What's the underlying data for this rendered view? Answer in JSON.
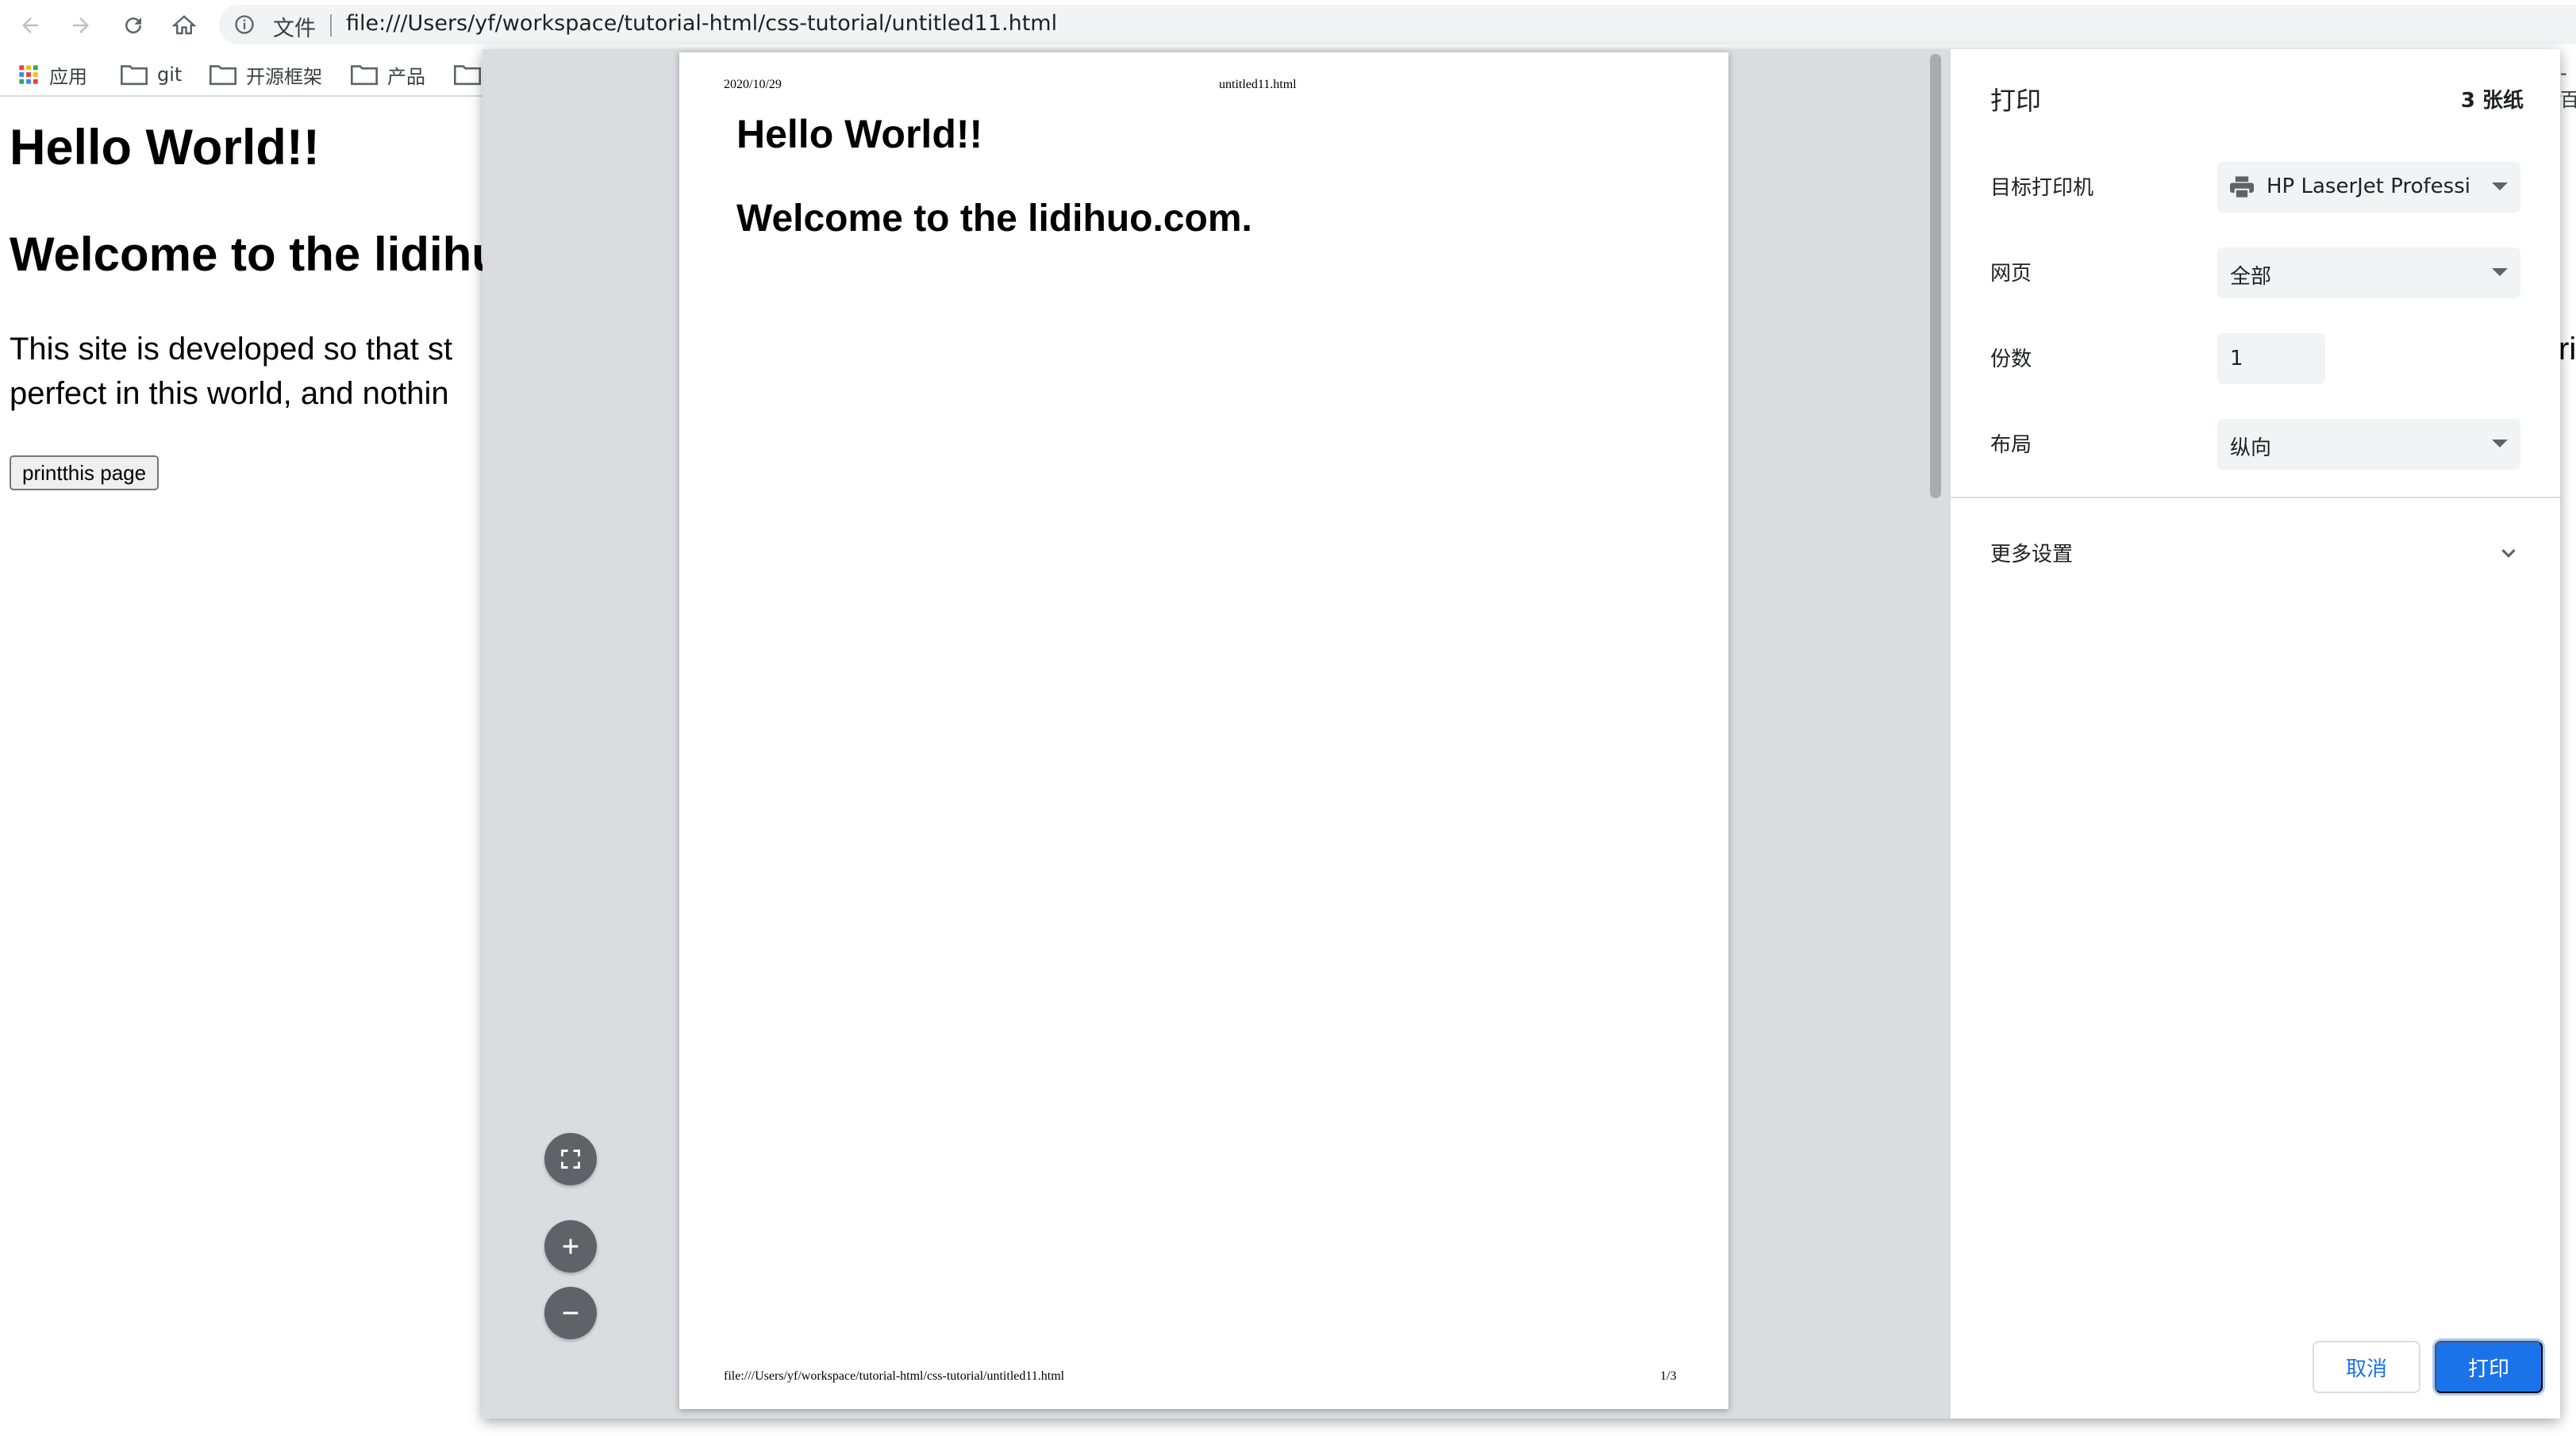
{
  "browser": {
    "origin_label": "文件",
    "url": "file:///Users/yf/workspace/tutorial-html/css-tutorial/untitled11.html",
    "bookmarks": [
      {
        "label": "应用"
      },
      {
        "label": "git"
      },
      {
        "label": "开源框架"
      },
      {
        "label": "产品"
      }
    ],
    "bookmarks_right_fragment": "-百"
  },
  "page": {
    "h1": "Hello World!!",
    "h2": "Welcome to the lidihu",
    "p_line1": "This site is developed so that st",
    "p_line2": "perfect in this world, and nothin",
    "p_right_fragment": "ri",
    "button_label": "printthis page"
  },
  "preview": {
    "header_date": "2020/10/29",
    "header_title": "untitled11.html",
    "h1": "Hello World!!",
    "h2": "Welcome to the lidihuo.com.",
    "footer_url": "file:///Users/yf/workspace/tutorial-html/css-tutorial/untitled11.html",
    "footer_page": "1/3"
  },
  "print_settings": {
    "title": "打印",
    "sheet_count": "3 张纸",
    "destination_label": "目标打印机",
    "destination_value": "HP LaserJet Professio",
    "pages_label": "网页",
    "pages_value": "全部",
    "copies_label": "份数",
    "copies_value": "1",
    "layout_label": "布局",
    "layout_value": "纵向",
    "more_settings_label": "更多设置",
    "cancel_label": "取消",
    "print_label": "打印"
  },
  "colors": {
    "accent": "#1a73e8",
    "preview_bg": "#dadce0",
    "field_bg": "#f1f3f4"
  }
}
